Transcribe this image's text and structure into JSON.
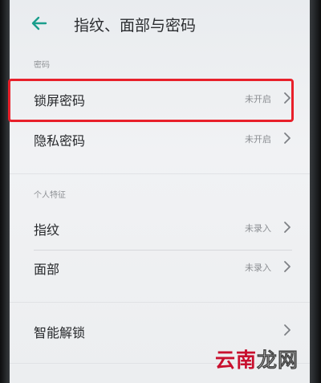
{
  "header": {
    "title": "指纹、面部与密码"
  },
  "sections": {
    "password_label": "密码",
    "personal_label": "个人特征"
  },
  "rows": {
    "lock_screen": {
      "label": "锁屏密码",
      "status": "未开启"
    },
    "privacy": {
      "label": "隐私密码",
      "status": "未开启"
    },
    "fingerprint": {
      "label": "指纹",
      "status": "未录入"
    },
    "face": {
      "label": "面部",
      "status": "未录入"
    },
    "smart_unlock": {
      "label": "智能解锁"
    }
  },
  "watermark": {
    "part1": "云南",
    "part2": "龙网"
  },
  "colors": {
    "accent": "#1a9e8c",
    "highlight": "#e8202a",
    "watermark_red": "#c8102e"
  },
  "icons": {
    "back": "arrow-left-icon",
    "chevron": "chevron-right-icon"
  }
}
